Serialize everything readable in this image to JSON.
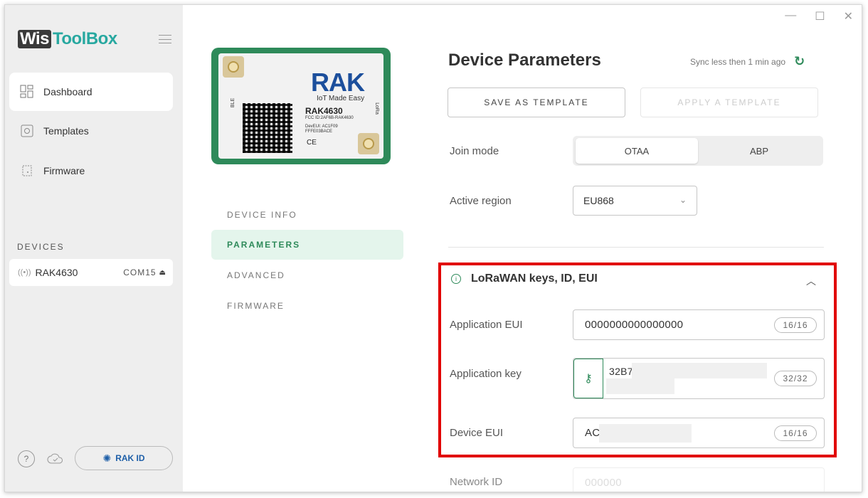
{
  "app": {
    "logo_wis": "Wis",
    "logo_toolbox": "ToolBox"
  },
  "sidebar": {
    "items": [
      {
        "label": "Dashboard",
        "icon": "dashboard-icon"
      },
      {
        "label": "Templates",
        "icon": "templates-icon"
      },
      {
        "label": "Firmware",
        "icon": "firmware-icon"
      }
    ],
    "devices_label": "DEVICES",
    "device": {
      "name": "RAK4630",
      "port": "COM15"
    },
    "help_label": "?",
    "rakid_label": "RAK ID"
  },
  "device_card": {
    "brand": "RAK",
    "tagline": "IoT Made Easy",
    "model": "RAK4630",
    "fcc": "FCC ID:2AF6B-RAK4630",
    "deveui_line1": "DevEUI: AC1F09",
    "deveui_line2": "FFFE03BACE",
    "ce_mark": "CE",
    "ble": "BLE",
    "lora": "LoRa"
  },
  "tabs": [
    {
      "label": "DEVICE INFO"
    },
    {
      "label": "PARAMETERS"
    },
    {
      "label": "ADVANCED"
    },
    {
      "label": "FIRMWARE"
    }
  ],
  "main": {
    "title": "Device Parameters",
    "sync_text": "Sync less then 1 min ago",
    "save_template": "SAVE AS TEMPLATE",
    "apply_template": "APPLY A TEMPLATE",
    "join_mode_label": "Join mode",
    "join_mode_options": [
      "OTAA",
      "ABP"
    ],
    "join_mode_selected": "OTAA",
    "active_region_label": "Active region",
    "active_region_value": "EU868",
    "section_title": "LoRaWAN keys, ID, EUI",
    "app_eui_label": "Application EUI",
    "app_eui_value": "0000000000000000",
    "app_eui_count": "16/16",
    "app_key_label": "Application key",
    "app_key_value": "32B7",
    "app_key_count": "32/32",
    "dev_eui_label": "Device EUI",
    "dev_eui_value": "AC",
    "dev_eui_count": "16/16",
    "network_id_label": "Network ID",
    "network_id_value": "000000"
  },
  "colors": {
    "accent_green": "#2e8a5a",
    "highlight_red": "#e10000",
    "rak_blue": "#1c4f9c"
  }
}
